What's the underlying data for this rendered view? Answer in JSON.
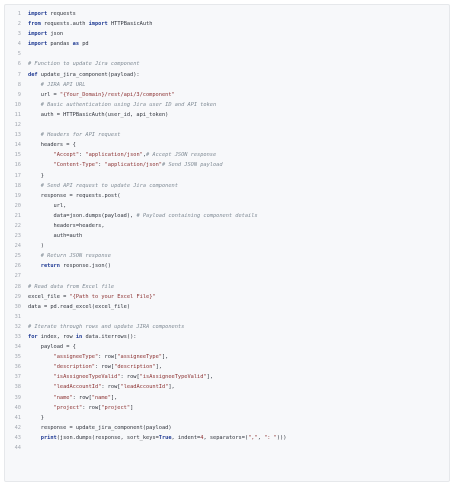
{
  "code_block": {
    "language": "python",
    "lines": [
      [
        {
          "t": "kw",
          "s": "import"
        },
        {
          "t": "",
          "s": " requests"
        }
      ],
      [
        {
          "t": "kw",
          "s": "from"
        },
        {
          "t": "",
          "s": " requests.auth "
        },
        {
          "t": "kw",
          "s": "import"
        },
        {
          "t": "",
          "s": " HTTPBasicAuth"
        }
      ],
      [
        {
          "t": "kw",
          "s": "import"
        },
        {
          "t": "",
          "s": " json"
        }
      ],
      [
        {
          "t": "kw",
          "s": "import"
        },
        {
          "t": "",
          "s": " pandas "
        },
        {
          "t": "kw",
          "s": "as"
        },
        {
          "t": "",
          "s": " pd"
        }
      ],
      [],
      [
        {
          "t": "cmt",
          "s": "# Function to update Jira component"
        }
      ],
      [
        {
          "t": "kw",
          "s": "def"
        },
        {
          "t": "",
          "s": " update_jira_component(payload):"
        }
      ],
      [
        {
          "t": "",
          "s": "    "
        },
        {
          "t": "cmt",
          "s": "# JIRA API URL"
        }
      ],
      [
        {
          "t": "",
          "s": "    url = "
        },
        {
          "t": "str",
          "s": "\"{Your_Domain}/rest/api/3/component\""
        }
      ],
      [
        {
          "t": "",
          "s": "    "
        },
        {
          "t": "cmt",
          "s": "# Basic authentication using Jira user ID and API token"
        }
      ],
      [
        {
          "t": "",
          "s": "    auth = HTTPBasicAuth(user_id, api_token)"
        }
      ],
      [],
      [
        {
          "t": "",
          "s": "    "
        },
        {
          "t": "cmt",
          "s": "# Headers for API request"
        }
      ],
      [
        {
          "t": "",
          "s": "    headers = {"
        }
      ],
      [
        {
          "t": "",
          "s": "        "
        },
        {
          "t": "str",
          "s": "\"Accept\""
        },
        {
          "t": "",
          "s": ": "
        },
        {
          "t": "str",
          "s": "\"application/json\""
        },
        {
          "t": "",
          "s": ","
        },
        {
          "t": "cmt",
          "s": "# Accept JSON response"
        }
      ],
      [
        {
          "t": "",
          "s": "        "
        },
        {
          "t": "str",
          "s": "\"Content-Type\""
        },
        {
          "t": "",
          "s": ": "
        },
        {
          "t": "str",
          "s": "\"application/json\""
        },
        {
          "t": "cmt",
          "s": "# Send JSON payload"
        }
      ],
      [
        {
          "t": "",
          "s": "    }"
        }
      ],
      [
        {
          "t": "",
          "s": "    "
        },
        {
          "t": "cmt",
          "s": "# Send API request to update Jira component"
        }
      ],
      [
        {
          "t": "",
          "s": "    response = requests.post("
        }
      ],
      [
        {
          "t": "",
          "s": "        url,"
        }
      ],
      [
        {
          "t": "",
          "s": "        data=json.dumps(payload), "
        },
        {
          "t": "cmt",
          "s": "# Payload containing component details"
        }
      ],
      [
        {
          "t": "",
          "s": "        headers=headers,"
        }
      ],
      [
        {
          "t": "",
          "s": "        auth=auth"
        }
      ],
      [
        {
          "t": "",
          "s": "    )"
        }
      ],
      [
        {
          "t": "",
          "s": "    "
        },
        {
          "t": "cmt",
          "s": "# Return JSON response"
        }
      ],
      [
        {
          "t": "",
          "s": "    "
        },
        {
          "t": "kw",
          "s": "return"
        },
        {
          "t": "",
          "s": " response.json()"
        }
      ],
      [],
      [
        {
          "t": "cmt",
          "s": "# Read data from Excel file"
        }
      ],
      [
        {
          "t": "",
          "s": "excel_file = "
        },
        {
          "t": "str",
          "s": "\"{Path to your Excel File}\""
        }
      ],
      [
        {
          "t": "",
          "s": "data = pd.read_excel(excel_file)"
        }
      ],
      [],
      [
        {
          "t": "cmt",
          "s": "# Iterate through rows and update JIRA components"
        }
      ],
      [
        {
          "t": "kw",
          "s": "for"
        },
        {
          "t": "",
          "s": " index, row "
        },
        {
          "t": "kw",
          "s": "in"
        },
        {
          "t": "",
          "s": " data.iterrows():"
        }
      ],
      [
        {
          "t": "",
          "s": "    payload = {"
        }
      ],
      [
        {
          "t": "",
          "s": "        "
        },
        {
          "t": "str",
          "s": "\"assigneeType\""
        },
        {
          "t": "",
          "s": ": row["
        },
        {
          "t": "str",
          "s": "\"assigneeType\""
        },
        {
          "t": "",
          "s": "],"
        }
      ],
      [
        {
          "t": "",
          "s": "        "
        },
        {
          "t": "str",
          "s": "\"description\""
        },
        {
          "t": "",
          "s": ": row["
        },
        {
          "t": "str",
          "s": "\"description\""
        },
        {
          "t": "",
          "s": "],"
        }
      ],
      [
        {
          "t": "",
          "s": "        "
        },
        {
          "t": "str",
          "s": "\"isAssigneeTypeValid\""
        },
        {
          "t": "",
          "s": ": row["
        },
        {
          "t": "str",
          "s": "\"isAssigneeTypeValid\""
        },
        {
          "t": "",
          "s": "],"
        }
      ],
      [
        {
          "t": "",
          "s": "        "
        },
        {
          "t": "str",
          "s": "\"leadAccountId\""
        },
        {
          "t": "",
          "s": ": row["
        },
        {
          "t": "str",
          "s": "\"leadAccountId\""
        },
        {
          "t": "",
          "s": "],"
        }
      ],
      [
        {
          "t": "",
          "s": "        "
        },
        {
          "t": "str",
          "s": "\"name\""
        },
        {
          "t": "",
          "s": ": row["
        },
        {
          "t": "str",
          "s": "\"name\""
        },
        {
          "t": "",
          "s": "],"
        }
      ],
      [
        {
          "t": "",
          "s": "        "
        },
        {
          "t": "str",
          "s": "\"project\""
        },
        {
          "t": "",
          "s": ": row["
        },
        {
          "t": "str",
          "s": "\"project\""
        },
        {
          "t": "",
          "s": "]"
        }
      ],
      [
        {
          "t": "",
          "s": "    }"
        }
      ],
      [
        {
          "t": "",
          "s": "    response = update_jira_component(payload)"
        }
      ],
      [
        {
          "t": "",
          "s": "    "
        },
        {
          "t": "bi",
          "s": "print"
        },
        {
          "t": "",
          "s": "(json.dumps(response, sort_keys="
        },
        {
          "t": "kw",
          "s": "True"
        },
        {
          "t": "",
          "s": ", indent="
        },
        {
          "t": "num",
          "s": "4"
        },
        {
          "t": "",
          "s": ", separators=("
        },
        {
          "t": "str",
          "s": "\",\""
        },
        {
          "t": "",
          "s": ", "
        },
        {
          "t": "str",
          "s": "\": \""
        },
        {
          "t": "",
          "s": ")))"
        }
      ],
      []
    ]
  }
}
